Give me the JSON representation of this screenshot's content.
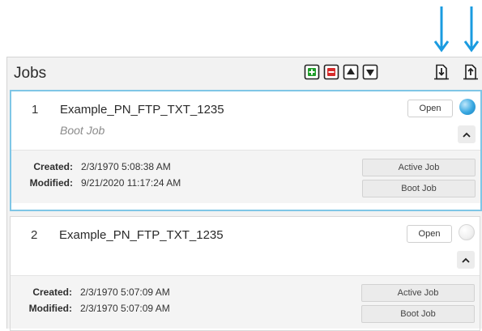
{
  "colors": {
    "annotation_arrow": "#1a9be0",
    "selected_border": "#7fc6e6",
    "active_status": "#37a7e0",
    "add_icon": "#1f9d2a",
    "remove_icon": "#d62b2b"
  },
  "panel": {
    "title": "Jobs",
    "toolbar": [
      {
        "name": "add-job-button",
        "icon": "add-icon"
      },
      {
        "name": "remove-job-button",
        "icon": "remove-icon"
      },
      {
        "name": "move-up-button",
        "icon": "move-up-icon"
      },
      {
        "name": "move-down-button",
        "icon": "move-down-icon"
      },
      {
        "name": "download-job-button",
        "icon": "download-icon"
      },
      {
        "name": "upload-job-button",
        "icon": "upload-icon"
      }
    ]
  },
  "jobs": [
    {
      "number": "1",
      "name": "Example_PN_FTP_TXT_1235",
      "subtitle": "Boot Job",
      "open_label": "Open",
      "status": "active",
      "created_label": "Created:",
      "created_value": "2/3/1970 5:08:38 AM",
      "modified_label": "Modified:",
      "modified_value": "9/21/2020 11:17:24 AM",
      "active_job_label": "Active Job",
      "boot_job_label": "Boot Job"
    },
    {
      "number": "2",
      "name": "Example_PN_FTP_TXT_1235",
      "subtitle": "",
      "open_label": "Open",
      "status": "idle",
      "created_label": "Created:",
      "created_value": "2/3/1970 5:07:09 AM",
      "modified_label": "Modified:",
      "modified_value": "2/3/1970 5:07:09 AM",
      "active_job_label": "Active Job",
      "boot_job_label": "Boot Job"
    }
  ]
}
